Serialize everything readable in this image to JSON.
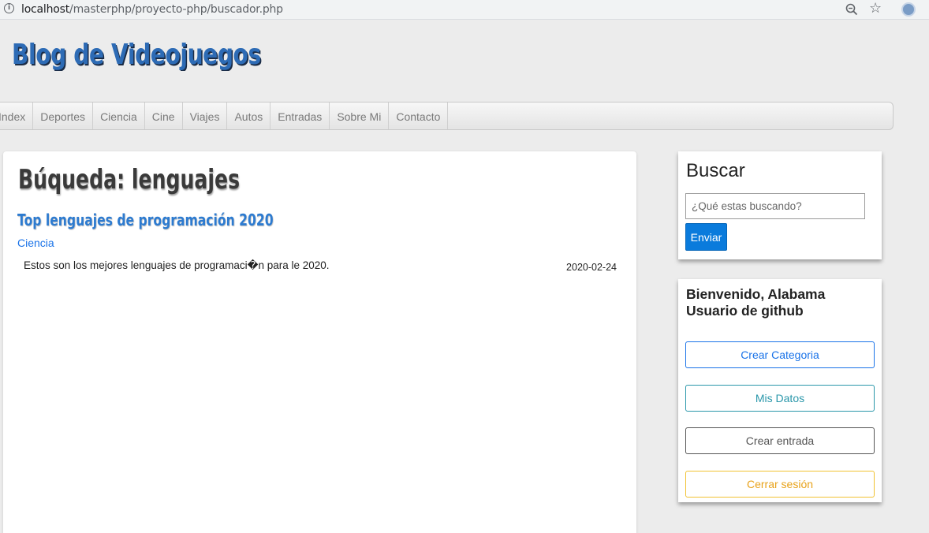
{
  "browser": {
    "url_host": "localhost",
    "url_path": "/masterphp/proyecto-php/buscador.php"
  },
  "header": {
    "title": "Blog de Videojuegos"
  },
  "nav": {
    "items": [
      "Index",
      "Deportes",
      "Ciencia",
      "Cine",
      "Viajes",
      "Autos",
      "Entradas",
      "Sobre Mi",
      "Contacto"
    ]
  },
  "main": {
    "heading": "Búqueda: lenguajes",
    "results": [
      {
        "title": "Top lenguajes de programación 2020",
        "category": "Ciencia",
        "description": "Estos son los mejores lenguajes de programaci�n para le 2020.",
        "date": "2020-02-24"
      }
    ]
  },
  "sidebar": {
    "search": {
      "title": "Buscar",
      "placeholder": "¿Qué estas buscando?",
      "button": "Enviar"
    },
    "user": {
      "welcome": "Bienvenido, Alabama Usuario de github",
      "buttons": [
        "Crear Categoria",
        "Mis Datos",
        "Crear entrada",
        "Cerrar sesión"
      ]
    }
  },
  "colors": {
    "title_blue": "#2d6bb5",
    "link_blue": "#1a73e8",
    "primary_button": "#0a7bdc",
    "info_button": "#2a97aa",
    "warning_button": "#f1c232",
    "page_background": "#ececec"
  }
}
